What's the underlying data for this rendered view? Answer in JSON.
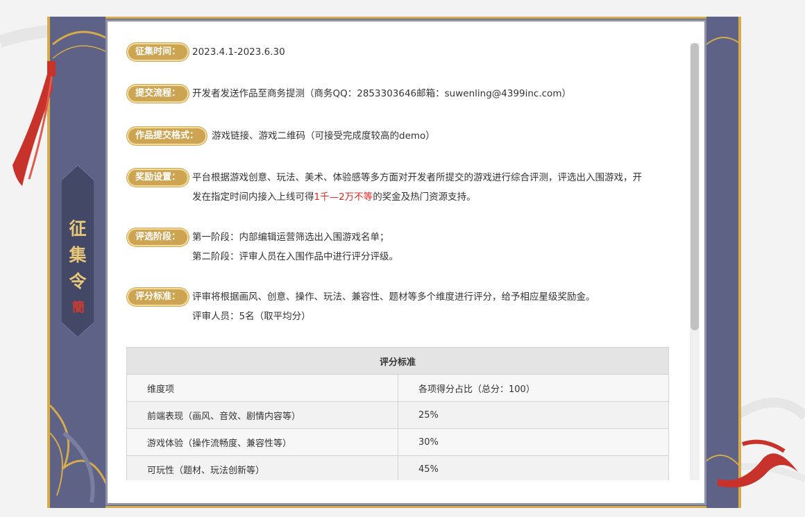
{
  "side_title": {
    "chars": [
      "征",
      "集",
      "令"
    ],
    "seal": "簡"
  },
  "sections": [
    {
      "label": "征集时间：",
      "lines": [
        "2023.4.1-2023.6.30"
      ]
    },
    {
      "label": "提交流程：",
      "lines": [
        "开发者发送作品至商务提测（商务QQ：2853303646邮箱：suwenling@4399inc.com）"
      ]
    },
    {
      "label": "作品提交格式：",
      "lines": [
        "游戏链接、游戏二维码（可接受完成度较高的demo）"
      ]
    },
    {
      "label": "奖励设置：",
      "line1": "平台根据游戏创意、玩法、美术、体验感等多方面对开发者所提交的游戏进行综合评测，评选出入围游戏，开",
      "line2_pre": "发在指定时间内接入上线可得",
      "line2_red": "1千—2万不等",
      "line2_post": "的奖金及热门资源支持。"
    },
    {
      "label": "评选阶段：",
      "lines": [
        "第一阶段：内部编辑运营筛选出入围游戏名单；",
        "第二阶段：评审人员在入围作品中进行评分评级。"
      ]
    },
    {
      "label": "评分标准：",
      "lines": [
        "评审将根据画风、创意、操作、玩法、兼容性、题材等多个维度进行评分，给予相应星级奖励金。",
        "评审人员：5名（取平均分）"
      ]
    }
  ],
  "table": {
    "title": "评分标准",
    "header": [
      "维度项",
      "各项得分占比（总分：100）"
    ],
    "rows": [
      [
        "前端表现（画风、音效、剧情内容等）",
        "25%"
      ],
      [
        "游戏体验（操作流畅度、兼容性等）",
        "30%"
      ],
      [
        "可玩性（题材、玩法创新等）",
        "45%"
      ]
    ]
  },
  "colors": {
    "frame": "#5b6184",
    "gold": "#cda552",
    "highlight": "#e0261e"
  }
}
